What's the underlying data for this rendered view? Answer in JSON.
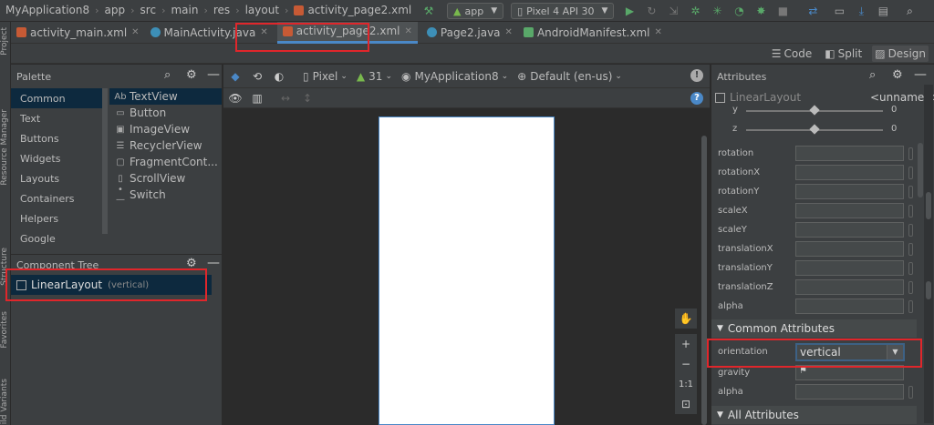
{
  "navbar": {
    "breadcrumbs": [
      "MyApplication8",
      "app",
      "src",
      "main",
      "res",
      "layout",
      "activity_page2.xml"
    ],
    "run_config": "app",
    "device": "Pixel 4 API 30"
  },
  "tabs": [
    {
      "label": "activity_main.xml",
      "type": "xml",
      "active": false
    },
    {
      "label": "MainActivity.java",
      "type": "java",
      "active": false
    },
    {
      "label": "activity_page2.xml",
      "type": "xml",
      "active": true
    },
    {
      "label": "Page2.java",
      "type": "java",
      "active": false
    },
    {
      "label": "AndroidManifest.xml",
      "type": "manifest",
      "active": false
    }
  ],
  "left_strip": [
    "Project",
    "Resource Manager",
    "Structure",
    "Favorites",
    "Build Variants"
  ],
  "view_modes": {
    "code": "Code",
    "split": "Split",
    "design": "Design"
  },
  "palette": {
    "title": "Palette",
    "categories": [
      "Common",
      "Text",
      "Buttons",
      "Widgets",
      "Layouts",
      "Containers",
      "Helpers",
      "Google"
    ],
    "widgets": [
      {
        "icon": "Ab",
        "label": "TextView"
      },
      {
        "icon": "▭",
        "label": "Button"
      },
      {
        "icon": "▣",
        "label": "ImageView"
      },
      {
        "icon": "☰",
        "label": "RecyclerView"
      },
      {
        "icon": "▢",
        "label": "FragmentCont..."
      },
      {
        "icon": "▯",
        "label": "ScrollView"
      },
      {
        "icon": "•—",
        "label": "Switch"
      }
    ]
  },
  "component_tree": {
    "title": "Component Tree",
    "root": {
      "label": "LinearLayout",
      "detail": "(vertical)"
    }
  },
  "design_toolbar": {
    "device": "Pixel",
    "api": "31",
    "app": "MyApplication8",
    "locale": "Default (en-us)"
  },
  "zoom_controls": {
    "one_to_one": "1:1"
  },
  "attributes": {
    "title": "Attributes",
    "component": "LinearLayout",
    "id": "<unnamed>",
    "sliders": [
      {
        "label": "y",
        "value": "0",
        "level": 0.5
      },
      {
        "label": "z",
        "value": "0",
        "level": 0.5
      }
    ],
    "transform_rows": [
      "rotation",
      "rotationX",
      "rotationY",
      "scaleX",
      "scaleY",
      "translationX",
      "translationY",
      "translationZ",
      "alpha"
    ],
    "common_section": "Common Attributes",
    "orientation_label": "orientation",
    "orientation_value": "vertical",
    "gravity_label": "gravity",
    "alpha_label": "alpha",
    "all_section": "All Attributes"
  }
}
